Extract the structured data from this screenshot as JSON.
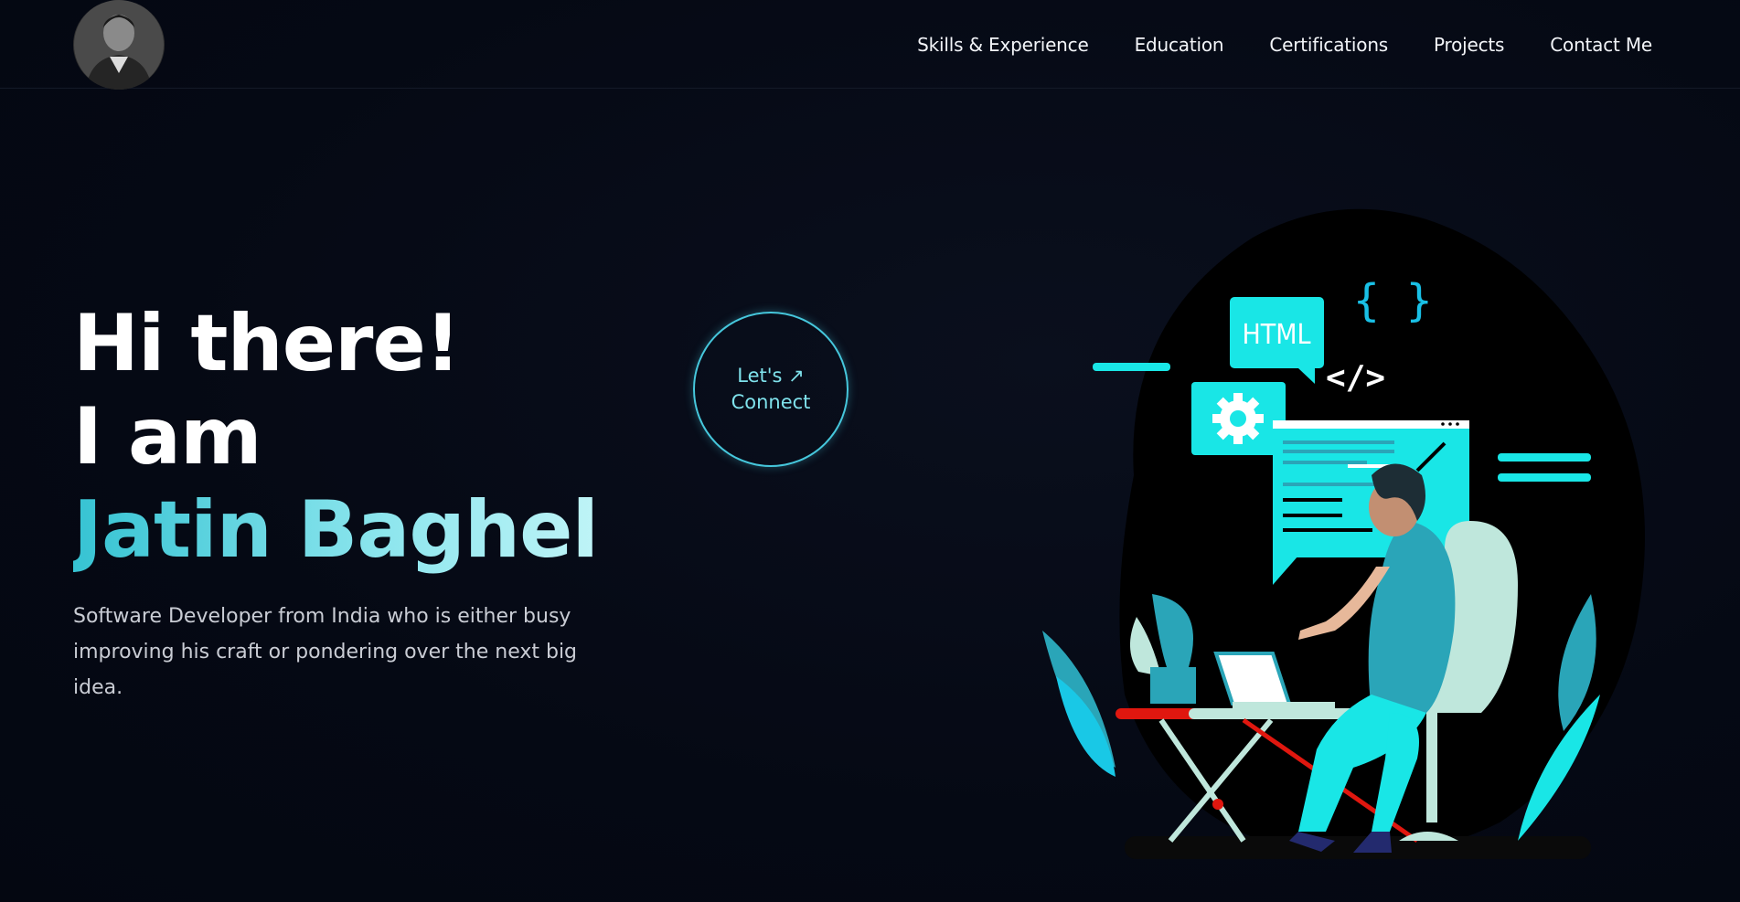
{
  "nav": {
    "avatar_alt": "Profile photo",
    "links": [
      "Skills & Experience",
      "Education",
      "Certifications",
      "Projects",
      "Contact Me"
    ]
  },
  "hero": {
    "line1": "Hi there!",
    "line2": "I am",
    "name": "Jatin Baghel",
    "description": "Software Developer from India who is either busy improving his craft or pondering over the next big idea."
  },
  "cta": {
    "line1": "Let's ↗",
    "line2": "Connect"
  },
  "illustration": {
    "html_label": "HTML",
    "braces": "{ }",
    "code_tag": "</>"
  },
  "colors": {
    "accent": "#19e6e6",
    "accent_dark": "#2aa5b8",
    "background": "#050914"
  }
}
